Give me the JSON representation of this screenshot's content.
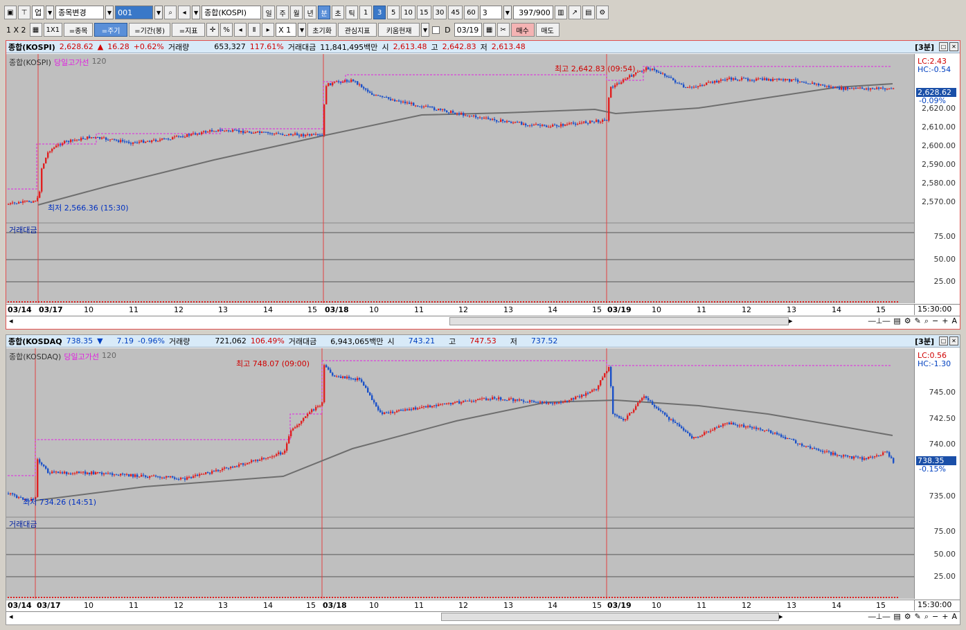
{
  "toolbar1": {
    "type_label": "업",
    "stock_change": "종목변경",
    "code": "001",
    "name": "종합(KOSPI)",
    "periods": [
      "일",
      "주",
      "월",
      "년",
      "분",
      "초",
      "틱"
    ],
    "minutes": [
      "1",
      "3",
      "5",
      "10",
      "15",
      "30",
      "45",
      "60"
    ],
    "count_select": "3",
    "count": "397/900"
  },
  "toolbar2": {
    "layout": "1 X 2",
    "btn_1x1": "1X1",
    "btn_stock": "=종목",
    "btn_period": "=주기",
    "btn_range": "=기간(봉)",
    "btn_indicator": "=지표",
    "btn_percent": "%",
    "zoom": "X 1",
    "btn_reset": "초기화",
    "btn_interest": "관심지표",
    "btn_kiwoom": "키움현재",
    "date_prefix": "D",
    "date": "03/19",
    "btn_buy": "매수",
    "btn_sell": "매도"
  },
  "panel1": {
    "name": "종합(KOSPI)",
    "price": "2,628.62",
    "arrow": "▲",
    "change": "16.28",
    "change_pct": "+0.62%",
    "vol_label": "거래량",
    "volume": "653,327",
    "vol_pct": "117.61%",
    "amt_label": "거래대금",
    "amount": "11,841,495백만",
    "open_label": "시",
    "open": "2,613.48",
    "high_label": "고",
    "high": "2,642.83",
    "low_label": "저",
    "low": "2,613.48",
    "period_tag": "[3분]",
    "legend": [
      "종합(KOSPI)",
      "당일고가선",
      "120"
    ],
    "vol_legend": "거래대금",
    "lc": "LC:2.43",
    "hc": "HC:-0.54",
    "cur_price": "2,628.62",
    "cur_pct": "-0.09%",
    "y_ticks": [
      "2,620.00",
      "2,610.00",
      "2,600.00",
      "2,590.00",
      "2,580.00",
      "2,570.00"
    ],
    "vol_ticks": [
      "75.00",
      "50.00",
      "25.00"
    ],
    "annot_high": "최고 2,642.83 (09:54)",
    "annot_low": "최저 2,566.36 (15:30)",
    "x_labels": [
      "03/14",
      "03/17",
      "10",
      "11",
      "12",
      "13",
      "14",
      "15",
      "03/18",
      "10",
      "11",
      "12",
      "13",
      "14",
      "15",
      "03/19",
      "10",
      "11",
      "12",
      "13",
      "14",
      "15"
    ],
    "x_time": "15:30:00"
  },
  "panel2": {
    "name": "종합(KOSDAQ",
    "price": "738.35",
    "arrow": "▼",
    "change": "7.19",
    "change_pct": "-0.96%",
    "vol_label": "거래량",
    "volume": "721,062",
    "vol_pct": "106.49%",
    "amt_label": "거래대금",
    "amount": "6,943,065백만",
    "open_label": "시",
    "open": "743.21",
    "high_label": "고",
    "high": "747.53",
    "low_label": "저",
    "low": "737.52",
    "period_tag": "[3분]",
    "legend": [
      "종합(KOSDAQ)",
      "당일고가선",
      "120"
    ],
    "vol_legend": "거래대금",
    "lc": "LC:0.56",
    "hc": "HC:-1.30",
    "cur_price": "738.35",
    "cur_pct": "-0.15%",
    "y_ticks": [
      "745.00",
      "742.50",
      "740.00",
      "735.00"
    ],
    "vol_ticks": [
      "75.00",
      "50.00",
      "25.00"
    ],
    "annot_high": "최고 748.07 (09:00)",
    "annot_low": "최저 734.26 (14:51)",
    "x_labels": [
      "03/14",
      "03/17",
      "10",
      "11",
      "12",
      "13",
      "14",
      "15",
      "03/18",
      "10",
      "11",
      "12",
      "13",
      "14",
      "15",
      "03/19",
      "10",
      "11",
      "12",
      "13",
      "14",
      "15"
    ],
    "x_time": "15:30:00"
  },
  "colors": {
    "up": "#e02020",
    "down": "#1a50c8",
    "ma": "#6e6e6e",
    "highline": "#e020e0",
    "bg": "#bfbfbf"
  }
}
